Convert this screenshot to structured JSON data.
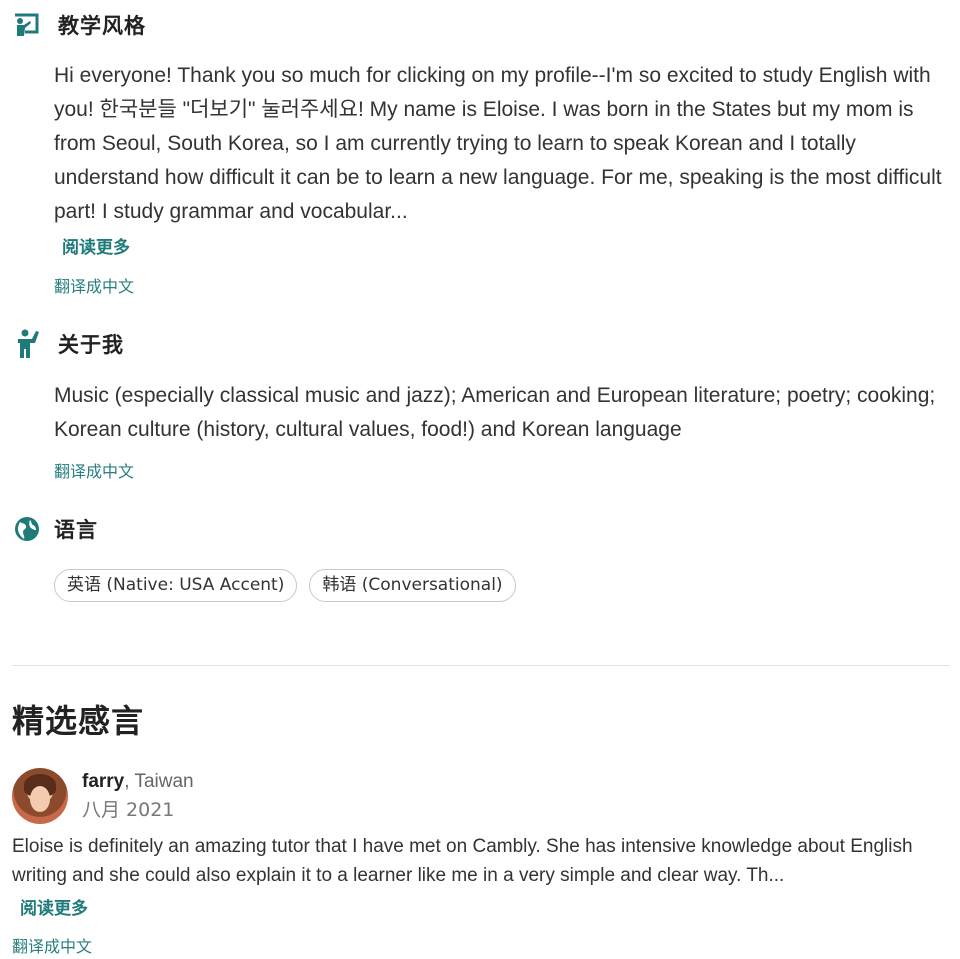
{
  "teaching_style": {
    "icon": "whiteboard-icon",
    "title": "教学风格",
    "body": "Hi everyone! Thank you so much for clicking on my profile--I'm so excited to study English with you! 한국분들 \"더보기\" 눌러주세요! My name is Eloise. I was born in the States but my mom is from Seoul, South Korea, so I am currently trying to learn to speak Korean and I totally understand how difficult it can be to learn a new language. For me, speaking is the most difficult part! I study grammar and vocabular...",
    "read_more": "阅读更多",
    "translate": "翻译成中文"
  },
  "about_me": {
    "icon": "person-waving-icon",
    "title": "关于我",
    "body": "Music (especially classical music and jazz); American and European literature; poetry; cooking; Korean culture (history, cultural values, food!) and Korean language",
    "translate": "翻译成中文"
  },
  "languages": {
    "icon": "globe-icon",
    "title": "语言",
    "tags": [
      "英语 (Native: USA Accent)",
      "韩语 (Conversational)"
    ]
  },
  "testimonials": {
    "title": "精选感言",
    "review": {
      "name": "farry",
      "location": ", Taiwan",
      "date": "八月 2021",
      "text": "Eloise is definitely an amazing tutor that I have met on Cambly. She has intensive knowledge about English writing and she could also explain it to a learner like me in a very simple and clear way. Th...",
      "read_more": "阅读更多",
      "translate": "翻译成中文"
    }
  },
  "colors": {
    "accent": "#1f7a7a",
    "text": "#333333",
    "divider": "#e2e2e2"
  }
}
